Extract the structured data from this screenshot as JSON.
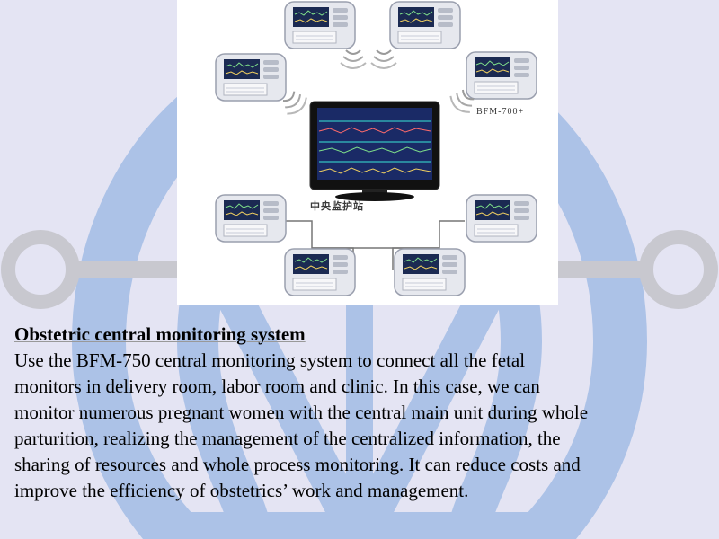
{
  "figure": {
    "model_label": "BFM-700+",
    "station_label": "中央监护站"
  },
  "text": {
    "heading": "Obstetric central monitoring system",
    "lines": [
      "Use the BFM-750 central monitoring system to connect all the fetal",
      "monitors in delivery room, labor room and clinic. In this case, we can",
      "monitor numerous pregnant women with the central main unit during whole",
      "parturition, realizing the management of the centralized information, the",
      "sharing of resources and whole process monitoring. It can reduce costs and",
      "improve the efficiency of obstetrics’ work and management."
    ]
  },
  "colors": {
    "background": "#e4e4f3",
    "emblem_blue": "#a6bfe6",
    "emblem_gray": "#c8c8cf",
    "monitor_screen": "#1a2a66",
    "device_body": "#e6e8ee"
  }
}
